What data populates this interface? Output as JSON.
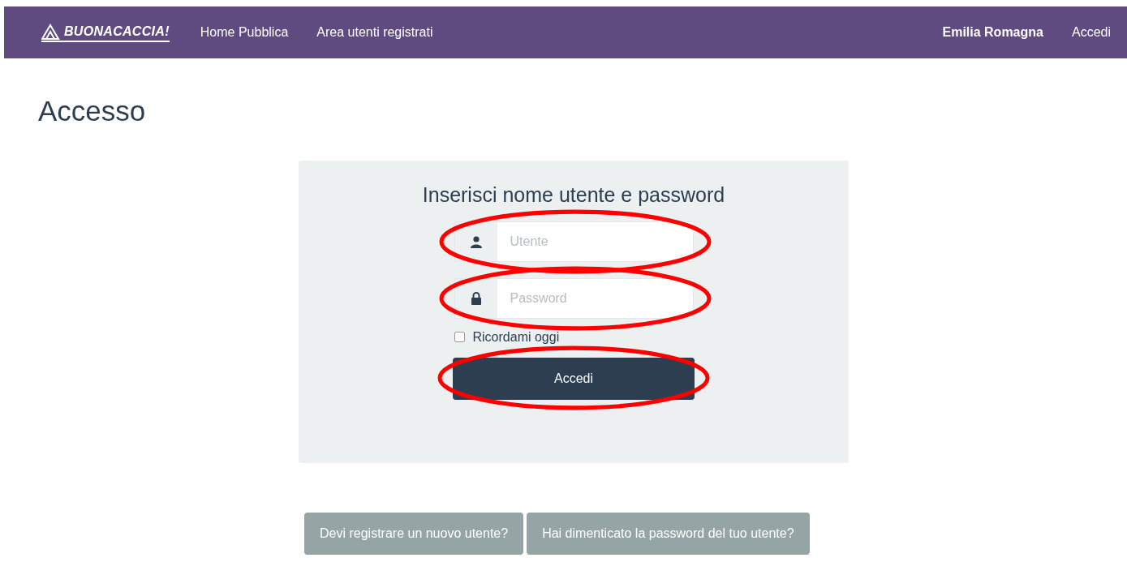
{
  "navbar": {
    "brand": "BUONACACCIA!",
    "links": [
      {
        "label": "Home Pubblica"
      },
      {
        "label": "Area utenti registrati"
      }
    ],
    "right": [
      {
        "label": "Emilia Romagna",
        "bold": true
      },
      {
        "label": "Accedi",
        "bold": false
      }
    ]
  },
  "page_title": "Accesso",
  "login_panel": {
    "heading": "Inserisci nome utente e password",
    "fields": [
      {
        "kind": "user",
        "placeholder": "Utente",
        "highlighted": true
      },
      {
        "kind": "password",
        "placeholder": "Password",
        "highlighted": true
      }
    ],
    "remember": {
      "label": "Ricordami oggi",
      "checked": false
    },
    "submit": {
      "label": "Accedi",
      "highlighted": true
    }
  },
  "footer_buttons": [
    "Devi registrare un nuovo utente?",
    "Hai dimenticato la password del tuo utente?"
  ]
}
